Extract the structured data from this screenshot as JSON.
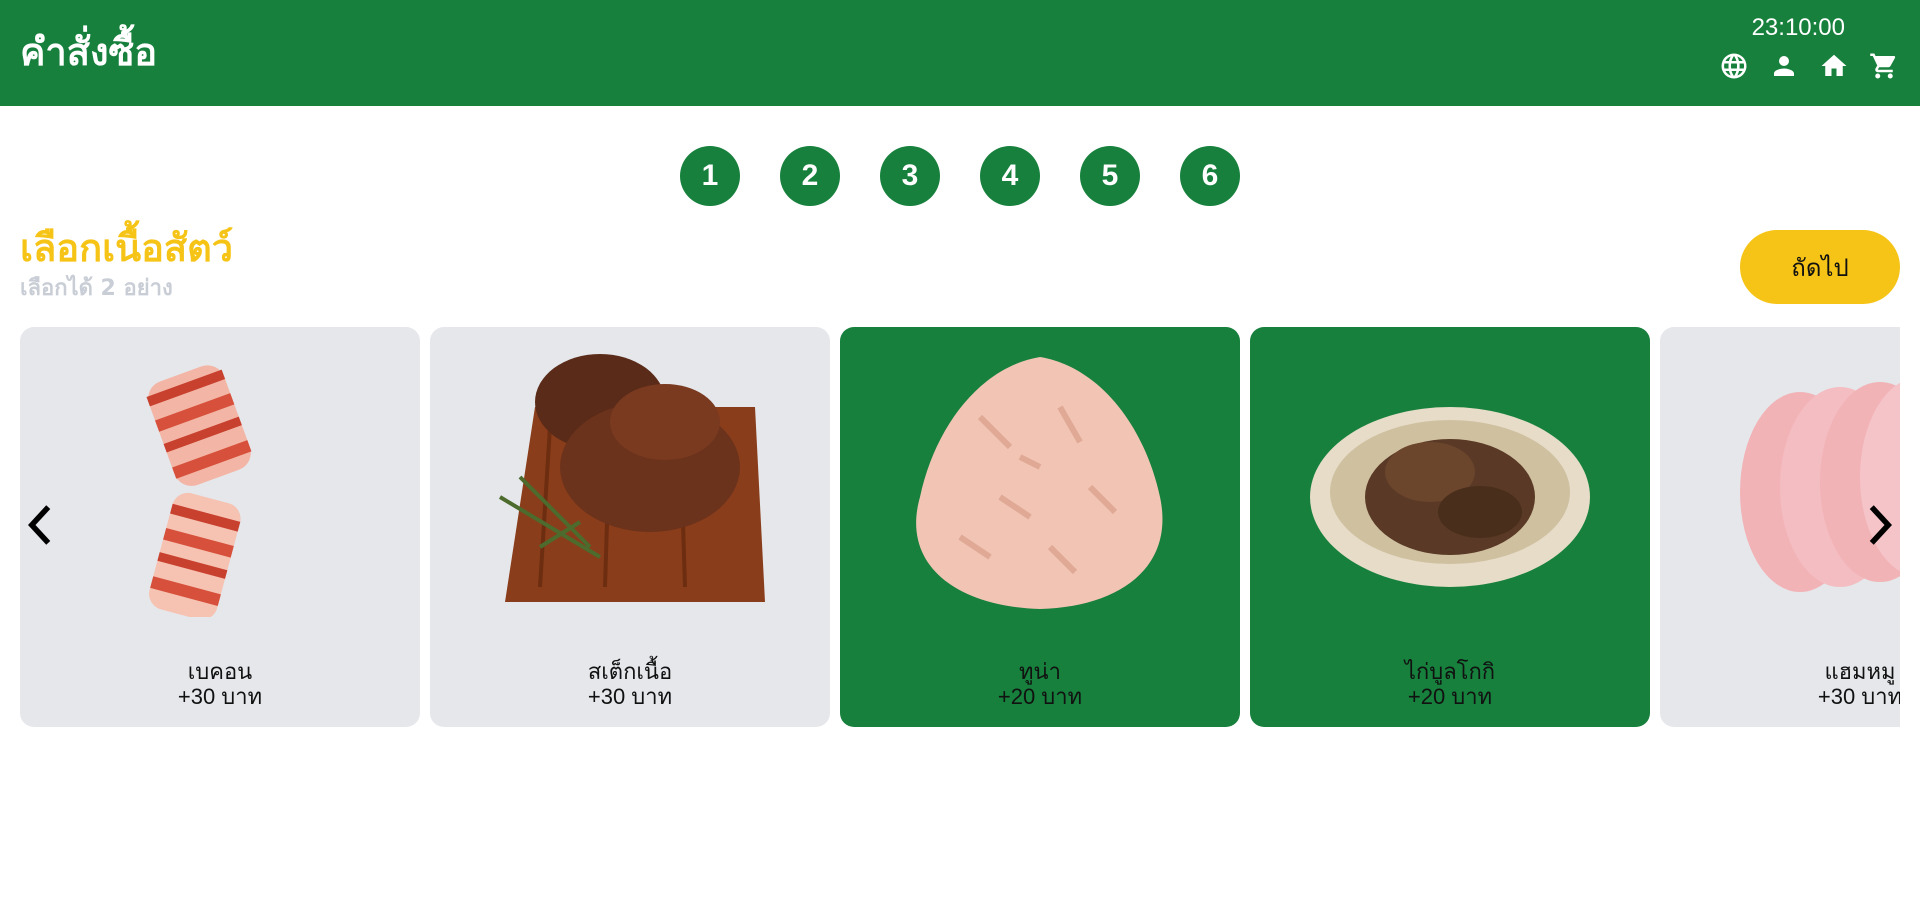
{
  "header": {
    "title": "คำสั่งซื้อ",
    "time": "23:10:00",
    "icons": [
      "globe-icon",
      "user-icon",
      "home-icon",
      "cart-icon"
    ]
  },
  "steps": [
    "1",
    "2",
    "3",
    "4",
    "5",
    "6"
  ],
  "section": {
    "title": "เลือกเนื้อสัตว์",
    "subtitle": "เลือกได้ 2 อย่าง",
    "next_label": "ถัดไป"
  },
  "items": [
    {
      "name": "เบคอน",
      "price": "+30 บาท",
      "selected": false
    },
    {
      "name": "สเต็กเนื้อ",
      "price": "+30 บาท",
      "selected": false
    },
    {
      "name": "ทูน่า",
      "price": "+20 บาท",
      "selected": true
    },
    {
      "name": "ไก่บูลโกกิ",
      "price": "+20 บาท",
      "selected": true
    },
    {
      "name": "แฮมหมู",
      "price": "+30 บาท",
      "selected": false
    }
  ],
  "colors": {
    "primary": "#16803c",
    "accent": "#f6c417",
    "card": "#e5e7eb"
  }
}
